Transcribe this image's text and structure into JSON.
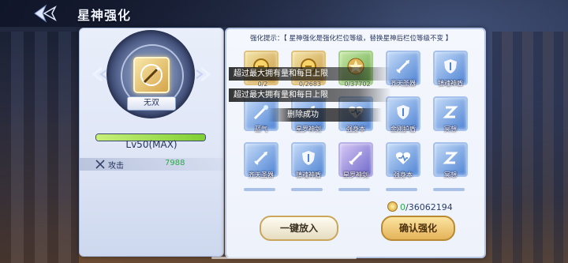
{
  "header": {
    "title": "星神强化"
  },
  "left": {
    "item_name": "无双",
    "exp_text": "",
    "exp_fraction": 1.0,
    "level": "Lv50(MAX)",
    "stat": {
      "label": "攻击",
      "value": "7988"
    }
  },
  "right": {
    "hint": "强化提示：【 星神强化是强化栏位等级，替换星神后栏位等级不变 】",
    "items": [
      {
        "style": "gold",
        "icon": "coin-icon",
        "label": "",
        "count": "0/2"
      },
      {
        "style": "gold",
        "icon": "coin-icon",
        "label": "",
        "count": "0/2683"
      },
      {
        "style": "green",
        "icon": "star-icon",
        "label": "",
        "count": "0/37702"
      },
      {
        "style": "blue",
        "icon": "sword-icon",
        "label": "齐天圣器",
        "count": ""
      },
      {
        "style": "blue",
        "icon": "shield-icon",
        "label": "镇魂神盾",
        "count": ""
      },
      {
        "style": "blue",
        "icon": "wand-icon",
        "label": "蓝气",
        "count": ""
      },
      {
        "style": "blue",
        "icon": "sword-icon",
        "label": "星罗神剑",
        "count": ""
      },
      {
        "style": "blue",
        "icon": "heart-icon",
        "label": "强身本",
        "count": ""
      },
      {
        "style": "blue",
        "icon": "shield-icon",
        "label": "金刚护盾",
        "count": ""
      },
      {
        "style": "blue",
        "icon": "z-icon",
        "label": "冥想",
        "count": ""
      },
      {
        "style": "blue",
        "icon": "sword-icon",
        "label": "齐天圣器",
        "count": ""
      },
      {
        "style": "blue",
        "icon": "shield-icon",
        "label": "镇魂神盾",
        "count": ""
      },
      {
        "style": "purple",
        "icon": "sword-icon",
        "label": "星罗神剑",
        "count": ""
      },
      {
        "style": "blue",
        "icon": "heart-icon",
        "label": "强身本",
        "count": ""
      },
      {
        "style": "blue",
        "icon": "z-icon",
        "label": "冥想",
        "count": ""
      }
    ],
    "coins": {
      "have": "0",
      "need": "/36062194"
    },
    "btn_put": "一键放入",
    "btn_confirm": "确认强化"
  },
  "toasts": {
    "t1": "超过最大拥有量和每日上限",
    "t2": "超过最大拥有量和每日上限",
    "t3": "删除成功"
  }
}
